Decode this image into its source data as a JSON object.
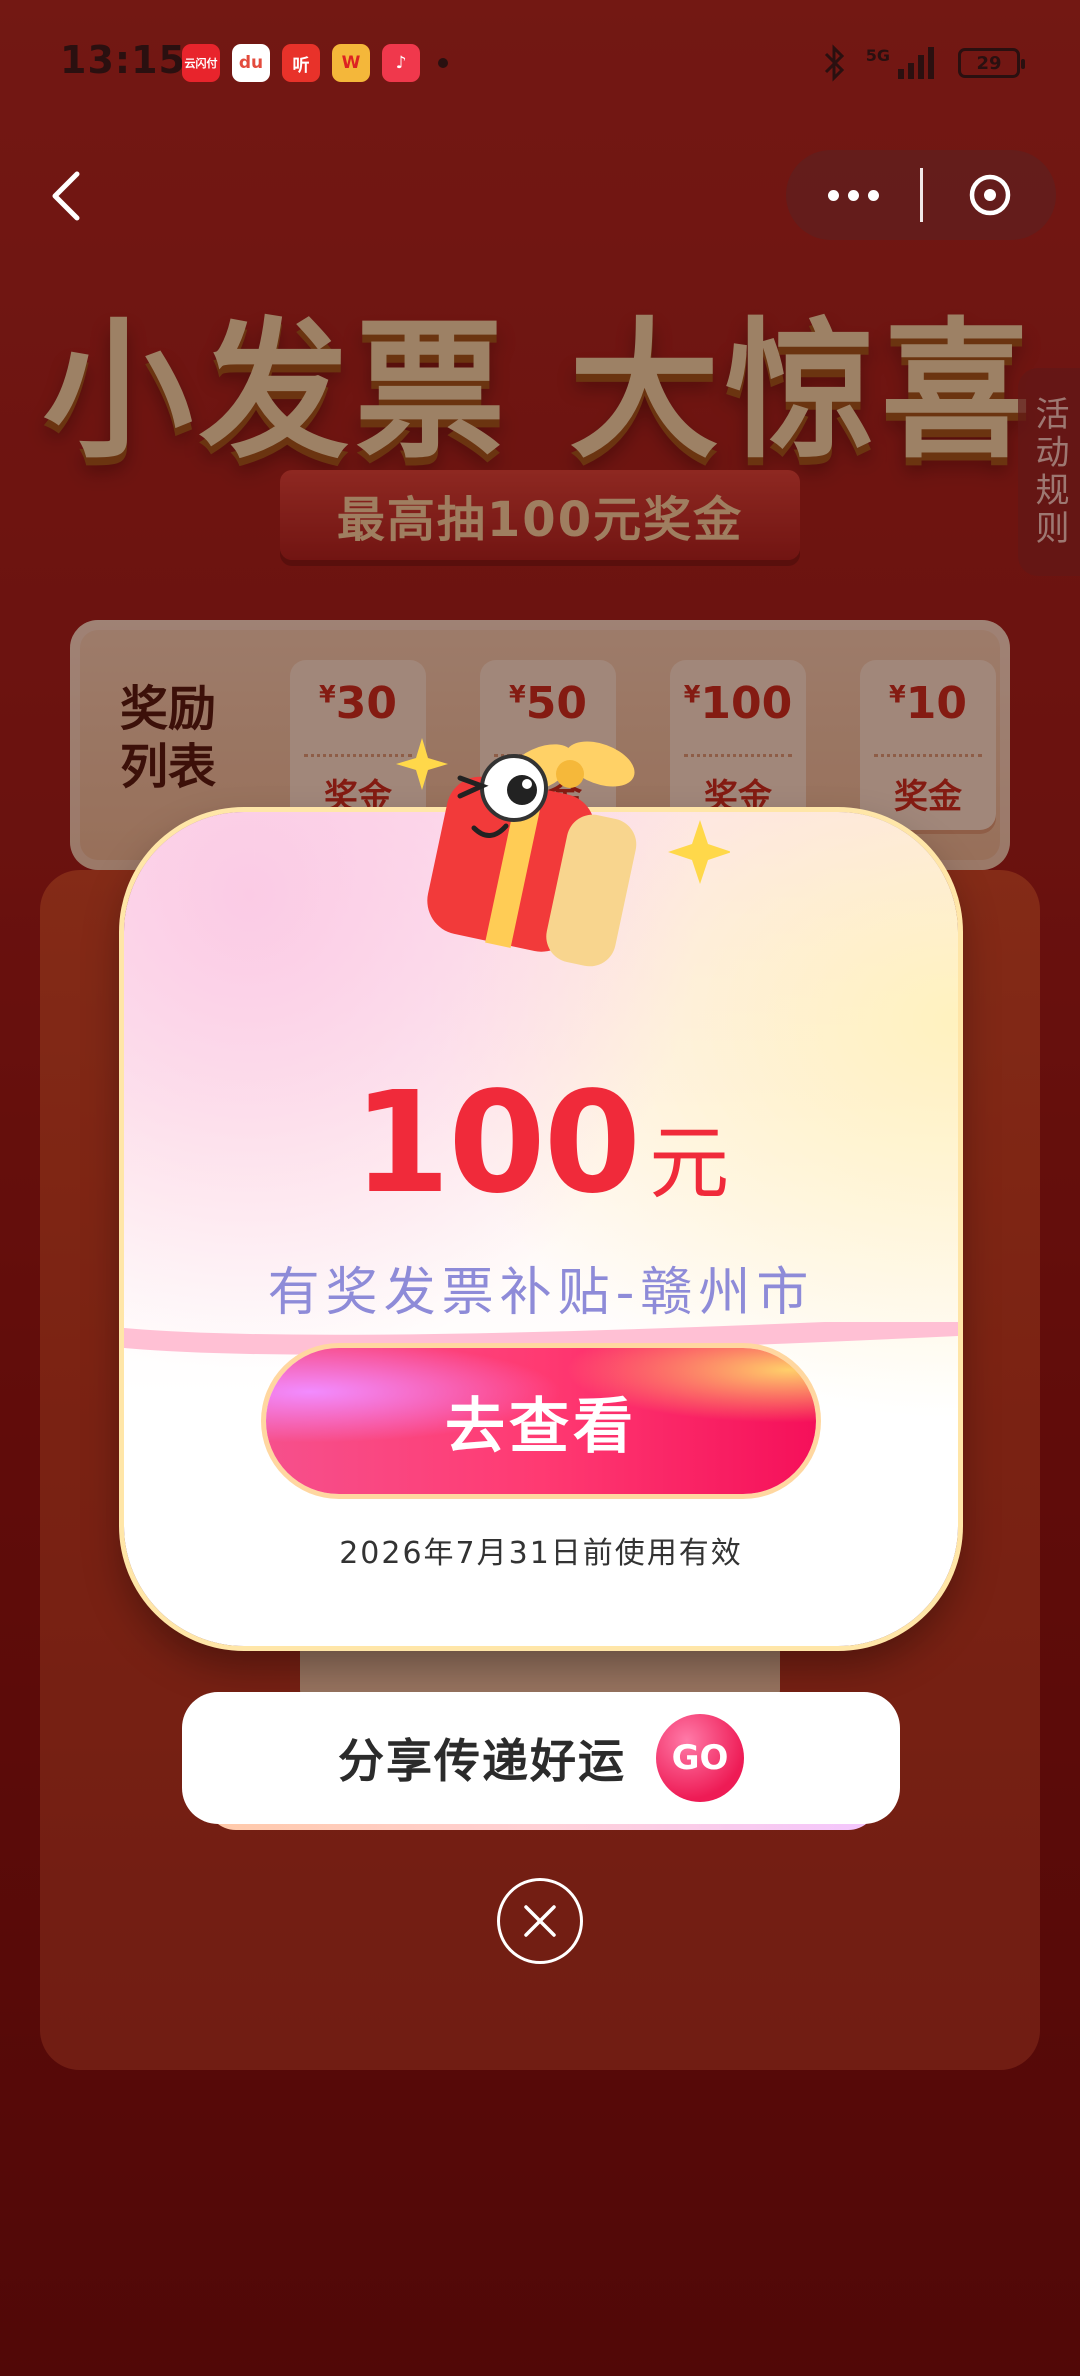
{
  "status_bar": {
    "time": "13:15",
    "apps": [
      {
        "name": "app-icon-1",
        "glyph": "云闪付",
        "color": "#e8242c"
      },
      {
        "name": "map-icon",
        "glyph": "du",
        "color": "#ffffff"
      },
      {
        "name": "ting-icon",
        "glyph": "听",
        "color": "#e8322a"
      },
      {
        "name": "weibo-icon",
        "glyph": "W",
        "color": "#f4b73a"
      },
      {
        "name": "music-icon",
        "glyph": "♪",
        "color": "#f0384c"
      }
    ],
    "network": "5G",
    "battery": "29"
  },
  "nav": {
    "more_icon": "more-dots-icon",
    "close_icon": "close-circle-icon"
  },
  "banner": {
    "title": "小发票 大惊喜",
    "subtitle": "最高抽100元奖金"
  },
  "rules_tab": "活动规则",
  "rewards": {
    "label": "奖励列表",
    "items": [
      {
        "currency": "¥",
        "amount": "30",
        "unit": "奖金"
      },
      {
        "currency": "¥",
        "amount": "50",
        "unit": "奖金"
      },
      {
        "currency": "¥",
        "amount": "100",
        "unit": "奖金"
      },
      {
        "currency": "¥",
        "amount": "10",
        "unit": "奖金"
      }
    ]
  },
  "modal": {
    "amount": "100",
    "unit": "元",
    "subsidy_title": "有奖发票补贴-赣州市",
    "view_button": "去查看",
    "validity": "2026年7月31日前使用有效"
  },
  "share": {
    "label": "分享传递好运",
    "go": "GO"
  },
  "colors": {
    "accent_red": "#f02a3a",
    "subsidy_purple": "#8e8bd8",
    "button_pink": "#ff3a72"
  }
}
